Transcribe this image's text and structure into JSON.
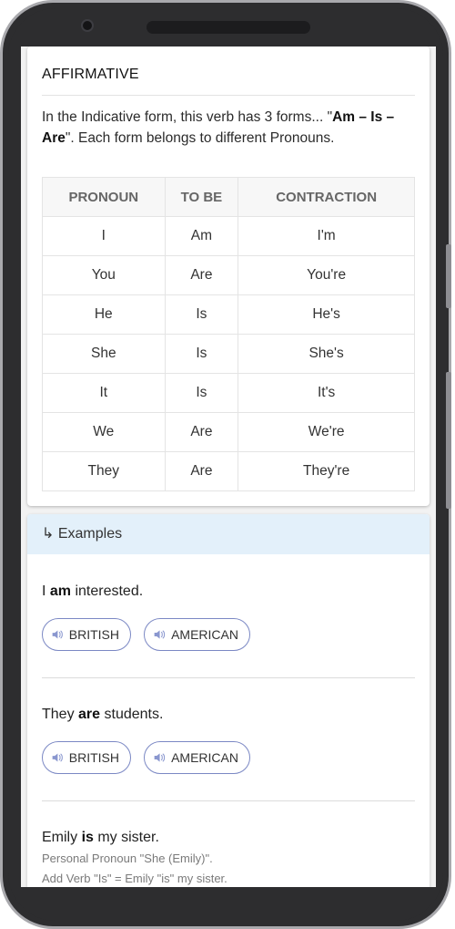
{
  "affirmative": {
    "title": "AFFIRMATIVE",
    "intro_part1": "In the Indicative form, this verb has 3 forms... \"",
    "intro_bold": "Am – Is – Are",
    "intro_part2": "\". Each form belongs to different Pronouns.",
    "table": {
      "headers": [
        "PRONOUN",
        "TO BE",
        "CONTRACTION"
      ],
      "rows": [
        [
          "I",
          "Am",
          "I'm"
        ],
        [
          "You",
          "Are",
          "You're"
        ],
        [
          "He",
          "Is",
          "He's"
        ],
        [
          "She",
          "Is",
          "She's"
        ],
        [
          "It",
          "Is",
          "It's"
        ],
        [
          "We",
          "Are",
          "We're"
        ],
        [
          "They",
          "Are",
          "They're"
        ]
      ]
    }
  },
  "examples": {
    "header_icon": "↳",
    "header_label": "Examples",
    "items": [
      {
        "before": "I ",
        "bold": "am",
        "after": " interested."
      },
      {
        "before": "They ",
        "bold": "are",
        "after": " students."
      },
      {
        "before": "Emily ",
        "bold": "is",
        "after": " my sister."
      }
    ],
    "note1": "Personal Pronoun \"She (Emily)\".",
    "note2": "Add Verb \"Is\" = Emily \"is\" my sister.",
    "british_label": "BRITISH",
    "american_label": "AMERICAN"
  },
  "colors": {
    "accent": "#7b88c4",
    "examples_header_bg": "#e3f0fa",
    "speaker_icon": "#8a97cf"
  }
}
